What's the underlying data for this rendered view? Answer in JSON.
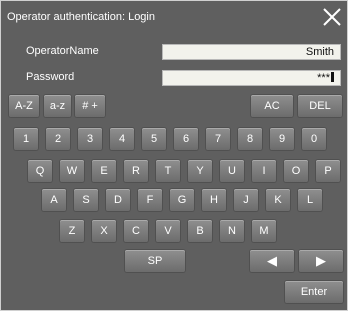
{
  "dialog": {
    "title": "Operator authentication: Login",
    "close_icon": "close-icon"
  },
  "form": {
    "operator_label": "OperatorName",
    "operator_value": "Smith",
    "password_label": "Password",
    "password_value": "***"
  },
  "keyboard": {
    "mode_upper": "A-Z",
    "mode_lower": "a-z",
    "mode_symbols": "# +",
    "all_clear": "AC",
    "delete": "DEL",
    "number_row": [
      "1",
      "2",
      "3",
      "4",
      "5",
      "6",
      "7",
      "8",
      "9",
      "0"
    ],
    "row_q": [
      "Q",
      "W",
      "E",
      "R",
      "T",
      "Y",
      "U",
      "I",
      "O",
      "P"
    ],
    "row_a": [
      "A",
      "S",
      "D",
      "F",
      "G",
      "H",
      "J",
      "K",
      "L"
    ],
    "row_z": [
      "Z",
      "X",
      "C",
      "V",
      "B",
      "N",
      "M"
    ],
    "space": "SP",
    "arrow_left": "◀",
    "arrow_right": "▶",
    "enter": "Enter"
  },
  "colors": {
    "panel": "#5f5f5f",
    "key": "#7d7d7d",
    "field": "#f2f2ec"
  }
}
